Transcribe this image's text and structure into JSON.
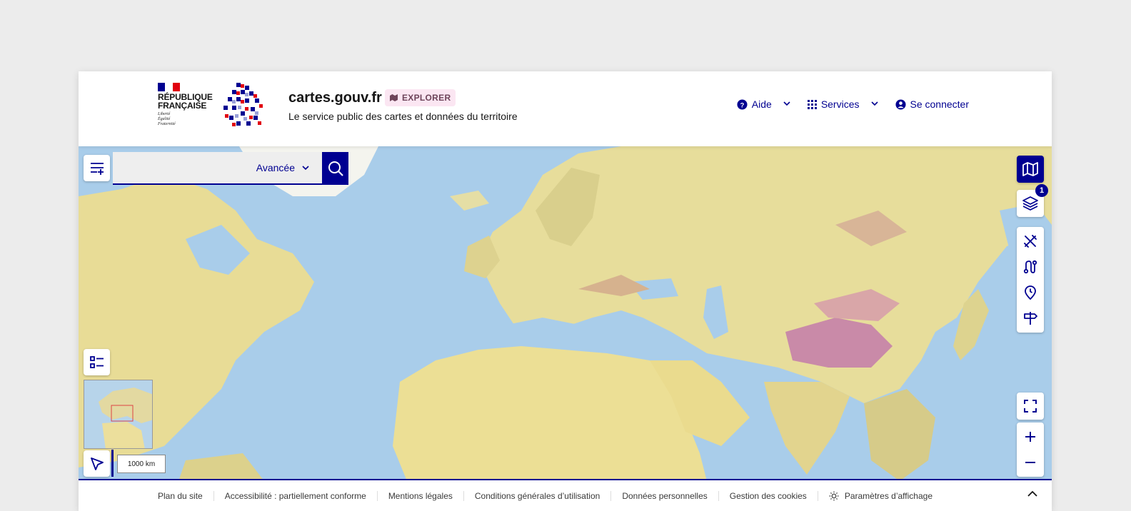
{
  "header": {
    "republic_line1": "République",
    "republic_line2": "Française",
    "motto": [
      "Liberté",
      "Égalité",
      "Fraternité"
    ],
    "site_title": "cartes.gouv.fr",
    "badge_label": "EXPLORER",
    "subtitle": "Le service public des cartes et données du territoire",
    "nav": [
      {
        "label": "Aide",
        "icon": "question-circle-icon",
        "dropdown": true
      },
      {
        "label": "Services",
        "icon": "grid-icon",
        "dropdown": true
      },
      {
        "label": "Se connecter",
        "icon": "user-icon",
        "dropdown": false
      }
    ]
  },
  "search": {
    "mode_label": "Avancée",
    "placeholder": ""
  },
  "map": {
    "layers_count": "1",
    "scale_label": "1000 km"
  },
  "colors": {
    "brand_blue": "#000091",
    "flag_blue": "#000091",
    "flag_red": "#e1000f",
    "badge_bg": "#fbe6f2",
    "ocean": "#a9cdea",
    "land": "#e9df9c"
  },
  "footer": {
    "links": [
      "Plan du site",
      "Accessibilité : partiellement conforme",
      "Mentions légales",
      "Conditions générales d’utilisation",
      "Données personnelles",
      "Gestion des cookies",
      "Paramètres d’affichage"
    ]
  }
}
